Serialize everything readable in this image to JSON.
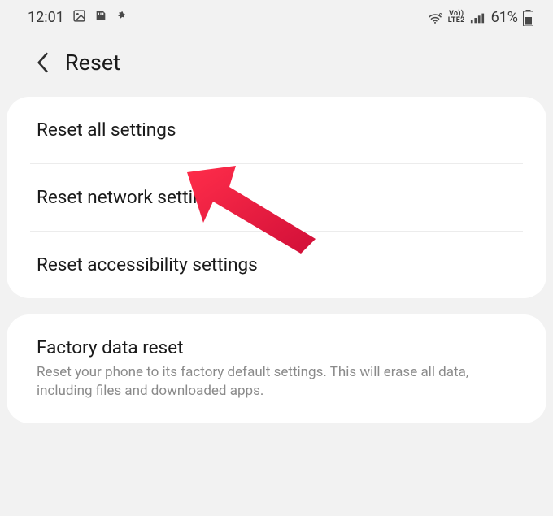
{
  "statusbar": {
    "time": "12:01",
    "lte_top": "Vo))",
    "lte_bottom": "LTE2",
    "battery_text": "61%"
  },
  "header": {
    "title": "Reset"
  },
  "group1": {
    "items": [
      {
        "title": "Reset all settings"
      },
      {
        "title": "Reset network settings"
      },
      {
        "title": "Reset accessibility settings"
      }
    ]
  },
  "group2": {
    "item": {
      "title": "Factory data reset",
      "subtitle": "Reset your phone to its factory default settings. This will erase all data, including files and downloaded apps."
    }
  }
}
